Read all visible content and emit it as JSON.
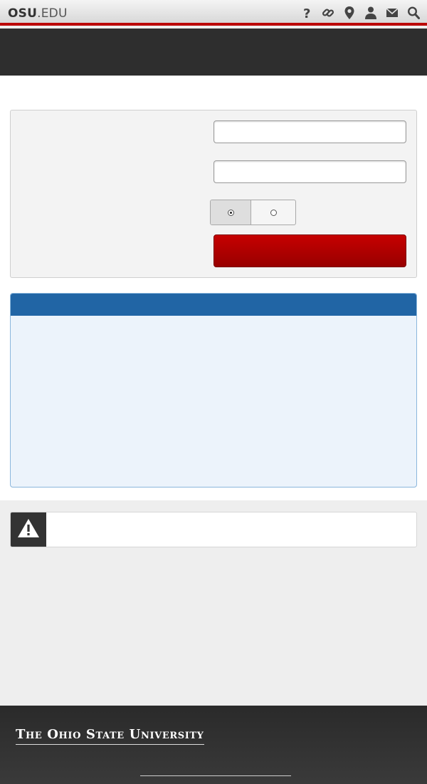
{
  "osu_bar": {
    "logo_bold": "OSU",
    "logo_rest": ".EDU",
    "icons": [
      "help-icon",
      "link-icon",
      "map-pin-icon",
      "person-icon",
      "mail-icon",
      "search-icon"
    ]
  },
  "login": {
    "username_value": "",
    "password_value": "",
    "toggle_selected_index": 0,
    "submit_label": ""
  },
  "info_box": {
    "heading": ""
  },
  "footer": {
    "university_name": "The Ohio State University"
  },
  "colors": {
    "scarlet": "#bb0000",
    "info_blue": "#2165a5",
    "dark_gray": "#2e2e2e"
  }
}
